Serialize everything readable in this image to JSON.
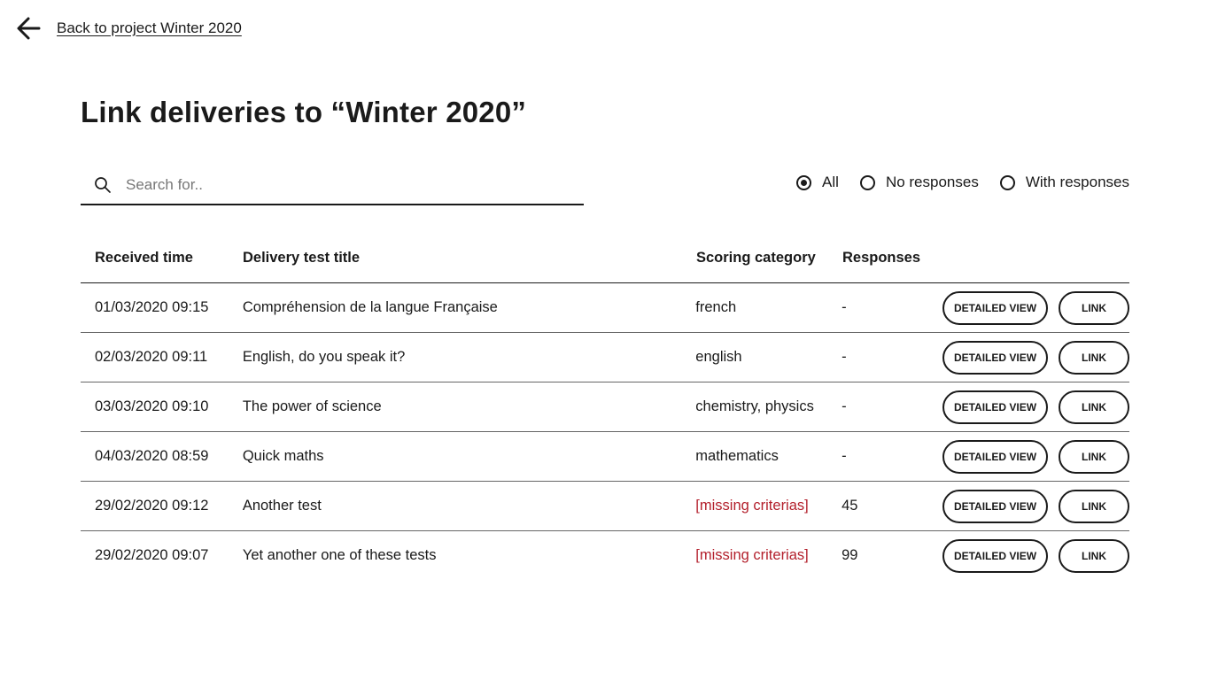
{
  "nav": {
    "back_label": "Back to project Winter 2020"
  },
  "page": {
    "title": "Link deliveries to “Winter 2020”"
  },
  "search": {
    "placeholder": "Search for..",
    "value": ""
  },
  "filters": {
    "options": [
      {
        "label": "All",
        "selected": true
      },
      {
        "label": "No responses",
        "selected": false
      },
      {
        "label": "With responses",
        "selected": false
      }
    ]
  },
  "table": {
    "headers": {
      "received_time": "Received time",
      "title": "Delivery test title",
      "scoring": "Scoring category",
      "responses": "Responses"
    },
    "rows": [
      {
        "time": "01/03/2020 09:15",
        "title": "Compréhension de la langue Française",
        "scoring": "french",
        "responses": "-",
        "detail_label": "DETAILED VIEW",
        "link_label": "LINK"
      },
      {
        "time": "02/03/2020 09:11",
        "title": "English, do you speak it?",
        "scoring": "english",
        "responses": "-",
        "detail_label": "DETAILED VIEW",
        "link_label": "LINK"
      },
      {
        "time": "03/03/2020 09:10",
        "title": "The power of science",
        "scoring": "chemistry, physics",
        "responses": "-",
        "detail_label": "DETAILED VIEW",
        "link_label": "LINK"
      },
      {
        "time": "04/03/2020 08:59",
        "title": "Quick maths",
        "scoring": "mathematics",
        "responses": "-",
        "detail_label": "DETAILED VIEW",
        "link_label": "LINK"
      },
      {
        "time": "29/02/2020 09:12",
        "title": "Another test",
        "scoring": "[missing criterias]",
        "responses": "45",
        "detail_label": "DETAILED VIEW",
        "link_label": "LINK"
      },
      {
        "time": "29/02/2020 09:07",
        "title": "Yet another one of these tests",
        "scoring": "[missing criterias]",
        "responses": "99",
        "detail_label": "DETAILED VIEW",
        "link_label": "LINK"
      }
    ]
  },
  "colors": {
    "text": "#1a1a1a",
    "missing": "#b3202c",
    "background": "#ffffff"
  },
  "icons": {
    "back": "arrow-left-icon",
    "search": "search-icon"
  }
}
